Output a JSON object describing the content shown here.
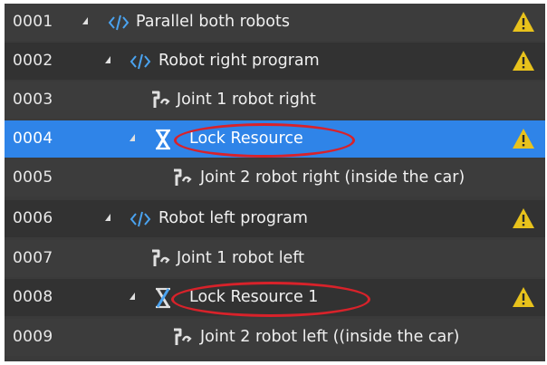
{
  "program_tree": {
    "rows": [
      {
        "number": "0001",
        "label": "Parallel both robots",
        "icon": "program-code-icon",
        "expanded": true,
        "warning": true,
        "selected": false
      },
      {
        "number": "0002",
        "label": "Robot right program",
        "icon": "program-code-icon",
        "expanded": true,
        "warning": true,
        "selected": false
      },
      {
        "number": "0003",
        "label": "Joint 1 robot right",
        "icon": "joint-move-icon",
        "expanded": null,
        "warning": false,
        "selected": false
      },
      {
        "number": "0004",
        "label": "Lock Resource",
        "icon": "lock-resource-icon",
        "expanded": true,
        "warning": true,
        "selected": true,
        "circled": true
      },
      {
        "number": "0005",
        "label": "Joint 2 robot right (inside the car)",
        "icon": "joint-move-icon",
        "expanded": null,
        "warning": false,
        "selected": false
      },
      {
        "number": "0006",
        "label": "Robot left program",
        "icon": "program-code-icon",
        "expanded": true,
        "warning": true,
        "selected": false
      },
      {
        "number": "0007",
        "label": "Joint 1 robot left",
        "icon": "joint-move-icon",
        "expanded": null,
        "warning": false,
        "selected": false
      },
      {
        "number": "0008",
        "label": "Lock Resource 1",
        "icon": "lock-resource-icon",
        "expanded": true,
        "warning": true,
        "selected": false,
        "circled": true
      },
      {
        "number": "0009",
        "label": "Joint 2 robot left ((inside the car)",
        "icon": "joint-move-icon",
        "expanded": null,
        "warning": false,
        "selected": false
      }
    ]
  },
  "colors": {
    "background": "#3a3a3a",
    "selection": "#2f84e8",
    "warning": "#e8c21c",
    "annotation": "#d8222a",
    "code_icon": "#4aa3f0"
  }
}
